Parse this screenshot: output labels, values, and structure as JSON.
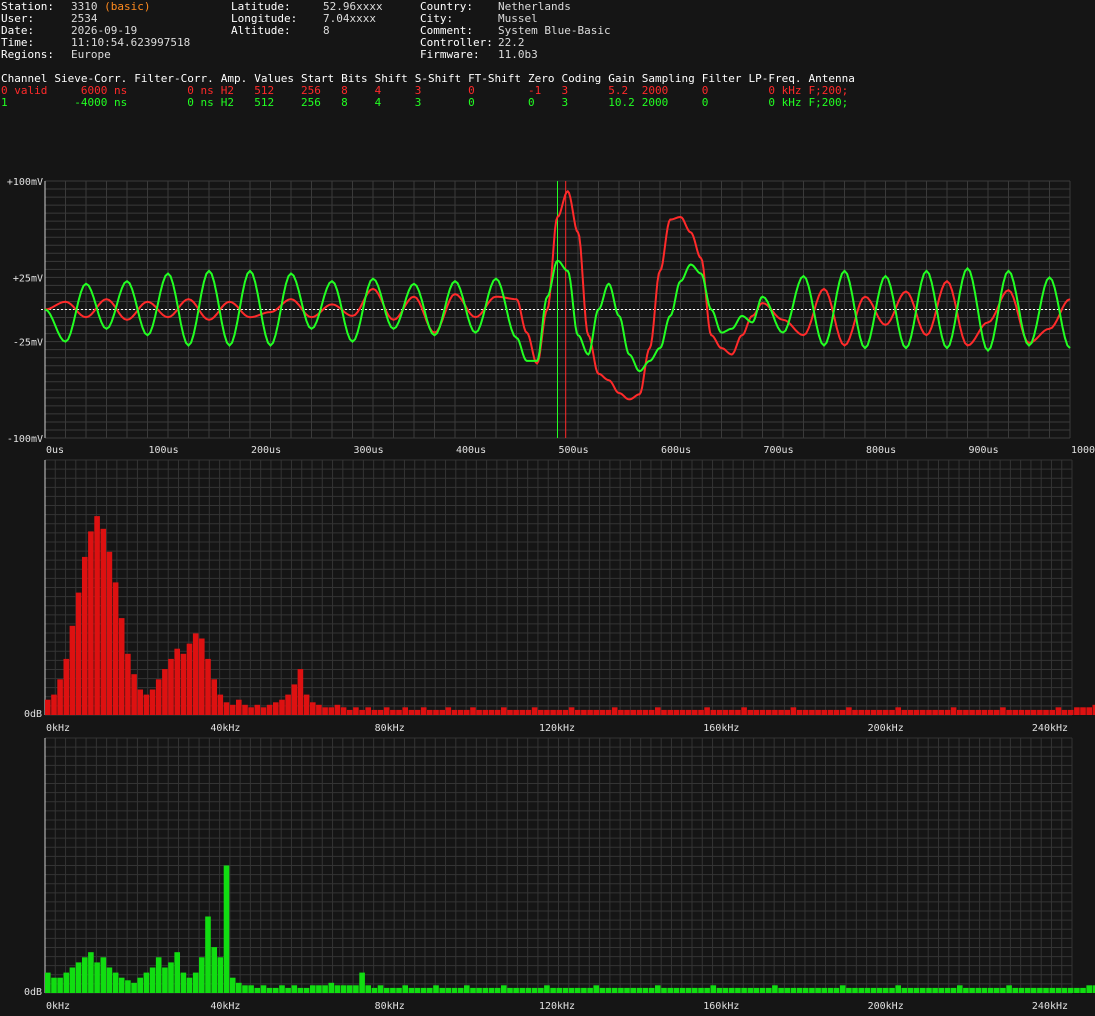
{
  "header": {
    "col1": [
      {
        "label": "Station:",
        "value": "3310",
        "suffix": "(basic)"
      },
      {
        "label": "User:",
        "value": "2534"
      },
      {
        "label": "Date:",
        "value": "2026-09-19"
      },
      {
        "label": "Time:",
        "value": "11:10:54.623997518"
      },
      {
        "label": "Regions:",
        "value": "Europe"
      }
    ],
    "col2": [
      {
        "label": "Latitude:",
        "value": "52.96xxxx"
      },
      {
        "label": "Longitude:",
        "value": "7.04xxxx"
      },
      {
        "label": "Altitude:",
        "value": "8"
      }
    ],
    "col3": [
      {
        "label": "Country:",
        "value": "Netherlands"
      },
      {
        "label": "City:",
        "value": "Mussel"
      },
      {
        "label": "Comment:",
        "value": "System Blue-Basic"
      },
      {
        "label": "Controller:",
        "value": "22.2"
      },
      {
        "label": "Firmware:",
        "value": "11.0b3"
      }
    ]
  },
  "channel_table": {
    "headers": [
      "Channel",
      "Sieve-Corr.",
      "Filter-Corr.",
      "Amp.",
      "Values",
      "Start",
      "Bits",
      "Shift",
      "S-Shift",
      "FT-Shift",
      "Zero",
      "Coding",
      "Gain",
      "Sampling",
      "Filter",
      "LP-Freq.",
      "Antenna"
    ],
    "rows": [
      {
        "color": "#ff2a2a",
        "cells": [
          "0 valid",
          "6000 ns",
          "0 ns",
          "H2",
          "512",
          "256",
          "8",
          "4",
          "3",
          "0",
          "-1",
          "3",
          "5.2",
          "2000",
          "0",
          "0 kHz",
          "F;200;"
        ]
      },
      {
        "color": "#22ff22",
        "cells": [
          "1",
          "-4000 ns",
          "0 ns",
          "H2",
          "512",
          "256",
          "8",
          "4",
          "3",
          "0",
          "0",
          "3",
          "10.2",
          "2000",
          "0",
          "0 kHz",
          "F;200;"
        ]
      }
    ]
  },
  "chart_data": [
    {
      "type": "line",
      "y_tick_labels": [
        "+100mV",
        "+25mV",
        "-25mV",
        "-100mV"
      ],
      "y_ticks": [
        100,
        25,
        -25,
        -100
      ],
      "ylim": [
        -100,
        100
      ],
      "xlim": [
        0,
        1000
      ],
      "x_tick_labels": [
        "0us",
        "100us",
        "200us",
        "300us",
        "400us",
        "500us",
        "600us",
        "700us",
        "800us",
        "900us",
        "1000us"
      ],
      "x_ticks": [
        0,
        100,
        200,
        300,
        400,
        500,
        600,
        700,
        800,
        900,
        1000
      ],
      "markers": [
        {
          "x": 500,
          "color": "#22ff22"
        },
        {
          "x": 508,
          "color": "#ff2a2a"
        }
      ],
      "grid": true,
      "series": [
        {
          "color": "#ff2a2a",
          "x": [
            0,
            20,
            40,
            60,
            80,
            100,
            120,
            140,
            160,
            180,
            200,
            220,
            240,
            260,
            280,
            300,
            320,
            340,
            360,
            380,
            400,
            420,
            440,
            460,
            470,
            480,
            490,
            500,
            510,
            520,
            530,
            540,
            550,
            560,
            570,
            580,
            590,
            600,
            610,
            620,
            630,
            640,
            650,
            660,
            670,
            680,
            690,
            700,
            720,
            740,
            760,
            780,
            800,
            820,
            840,
            860,
            880,
            900,
            920,
            940,
            960,
            980,
            1000
          ],
          "y": [
            0,
            6,
            -6,
            8,
            -8,
            6,
            -6,
            8,
            -8,
            6,
            -6,
            -2,
            8,
            -6,
            4,
            -5,
            16,
            -8,
            10,
            -18,
            12,
            -6,
            10,
            8,
            -18,
            -42,
            0,
            72,
            92,
            60,
            -20,
            -50,
            -55,
            -65,
            -70,
            -66,
            -30,
            30,
            70,
            72,
            60,
            40,
            -20,
            -30,
            -35,
            -20,
            -5,
            5,
            -8,
            -20,
            16,
            -28,
            10,
            -12,
            14,
            -20,
            22,
            -28,
            -10,
            15,
            -26,
            -15,
            8
          ]
        },
        {
          "color": "#22ff22",
          "x": [
            0,
            20,
            40,
            60,
            80,
            100,
            120,
            140,
            160,
            180,
            200,
            220,
            240,
            260,
            280,
            300,
            320,
            340,
            360,
            380,
            400,
            420,
            440,
            460,
            470,
            480,
            490,
            500,
            510,
            520,
            530,
            540,
            550,
            560,
            570,
            580,
            590,
            600,
            610,
            620,
            630,
            640,
            650,
            660,
            670,
            680,
            690,
            700,
            720,
            740,
            760,
            780,
            800,
            820,
            840,
            860,
            880,
            900,
            920,
            940,
            960,
            980,
            1000
          ],
          "y": [
            0,
            -25,
            20,
            -15,
            22,
            -20,
            28,
            -28,
            30,
            -28,
            30,
            -28,
            28,
            -15,
            22,
            -25,
            24,
            -15,
            20,
            -20,
            22,
            -18,
            24,
            -22,
            -40,
            -40,
            10,
            38,
            30,
            -20,
            -35,
            0,
            20,
            -5,
            -35,
            -48,
            -40,
            -30,
            -5,
            22,
            35,
            28,
            0,
            -18,
            -15,
            -5,
            -10,
            10,
            -18,
            26,
            -28,
            30,
            -30,
            26,
            -30,
            30,
            -30,
            32,
            -32,
            30,
            -28,
            25,
            -30
          ]
        }
      ]
    },
    {
      "type": "bar",
      "color": "#dd1111",
      "y_tick_label": "0dB",
      "x_tick_labels": [
        "0kHz",
        "40kHz",
        "80kHz",
        "120kHz",
        "160kHz",
        "200kHz",
        "240kHz"
      ],
      "x_ticks": [
        0,
        40,
        80,
        120,
        160,
        200,
        240
      ],
      "xlim": [
        0,
        250
      ],
      "ylim": [
        0,
        100
      ],
      "bin_width_khz": 1.5,
      "values": [
        6,
        8,
        14,
        22,
        35,
        48,
        62,
        72,
        78,
        73,
        64,
        52,
        38,
        24,
        16,
        10,
        8,
        10,
        14,
        18,
        22,
        26,
        24,
        28,
        32,
        30,
        22,
        14,
        8,
        5,
        4,
        6,
        4,
        3,
        4,
        3,
        4,
        5,
        6,
        8,
        12,
        18,
        8,
        5,
        4,
        3,
        3,
        4,
        3,
        2,
        3,
        2,
        3,
        2,
        2,
        3,
        2,
        2,
        3,
        2,
        2,
        3,
        2,
        2,
        2,
        3,
        2,
        2,
        2,
        3,
        2,
        2,
        2,
        2,
        3,
        2,
        2,
        2,
        2,
        3,
        2,
        2,
        2,
        2,
        2,
        3,
        2,
        2,
        2,
        2,
        2,
        2,
        3,
        2,
        2,
        2,
        2,
        2,
        2,
        3,
        2,
        2,
        2,
        2,
        2,
        2,
        2,
        3,
        2,
        2,
        2,
        2,
        2,
        3,
        2,
        2,
        2,
        2,
        2,
        2,
        2,
        3,
        2,
        2,
        2,
        2,
        2,
        2,
        2,
        2,
        3,
        2,
        2,
        2,
        2,
        2,
        2,
        2,
        3,
        2,
        2,
        2,
        2,
        2,
        2,
        2,
        2,
        3,
        2,
        2,
        2,
        2,
        2,
        2,
        2,
        3,
        2,
        2,
        2,
        2,
        2,
        2,
        2,
        2,
        3,
        2,
        2,
        3,
        3,
        3,
        4,
        4,
        4,
        5,
        5,
        5,
        6,
        7,
        8,
        9
      ]
    },
    {
      "type": "bar",
      "color": "#11dd11",
      "y_tick_label": "0dB",
      "x_tick_labels": [
        "0kHz",
        "40kHz",
        "80kHz",
        "120kHz",
        "160kHz",
        "200kHz",
        "240kHz"
      ],
      "x_ticks": [
        0,
        40,
        80,
        120,
        160,
        200,
        240
      ],
      "xlim": [
        0,
        250
      ],
      "ylim": [
        0,
        100
      ],
      "bin_width_khz": 1.5,
      "values": [
        8,
        6,
        6,
        8,
        10,
        12,
        14,
        16,
        12,
        14,
        10,
        8,
        6,
        5,
        4,
        6,
        8,
        10,
        14,
        10,
        12,
        16,
        8,
        6,
        8,
        14,
        30,
        18,
        14,
        50,
        6,
        4,
        3,
        3,
        2,
        3,
        2,
        2,
        3,
        2,
        3,
        2,
        2,
        3,
        3,
        3,
        4,
        3,
        3,
        3,
        3,
        8,
        3,
        2,
        3,
        2,
        2,
        2,
        3,
        2,
        2,
        2,
        2,
        3,
        2,
        2,
        2,
        2,
        3,
        2,
        2,
        2,
        2,
        2,
        3,
        2,
        2,
        2,
        2,
        2,
        2,
        3,
        2,
        2,
        2,
        2,
        2,
        2,
        2,
        3,
        2,
        2,
        2,
        2,
        2,
        2,
        2,
        2,
        2,
        3,
        2,
        2,
        2,
        2,
        2,
        2,
        2,
        2,
        3,
        2,
        2,
        2,
        2,
        2,
        2,
        2,
        2,
        2,
        3,
        2,
        2,
        2,
        2,
        2,
        2,
        2,
        2,
        2,
        2,
        3,
        2,
        2,
        2,
        2,
        2,
        2,
        2,
        2,
        3,
        2,
        2,
        2,
        2,
        2,
        2,
        2,
        2,
        2,
        3,
        2,
        2,
        2,
        2,
        2,
        2,
        2,
        3,
        2,
        2,
        2,
        2,
        2,
        2,
        2,
        2,
        2,
        2,
        2,
        2,
        3,
        3,
        3,
        3,
        3,
        3,
        3,
        3,
        4,
        4,
        4,
        5,
        5,
        5
      ]
    }
  ]
}
